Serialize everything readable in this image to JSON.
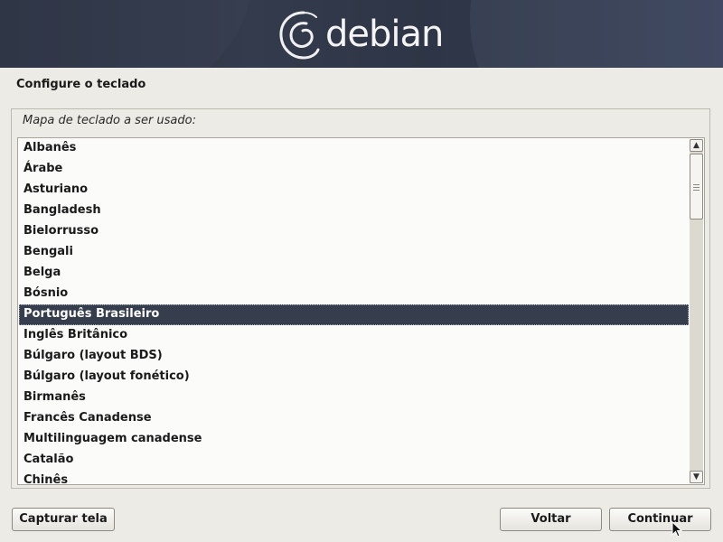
{
  "banner": {
    "logo_text": "debian"
  },
  "page": {
    "title": "Configure o teclado",
    "prompt": "Mapa de teclado a ser usado:"
  },
  "keymap_list": {
    "items": [
      "Albanês",
      "Árabe",
      "Asturiano",
      "Bangladesh",
      "Bielorrusso",
      "Bengali",
      "Belga",
      "Bósnio",
      "Português Brasileiro",
      "Inglês Britânico",
      "Búlgaro (layout BDS)",
      "Búlgaro (layout fonético)",
      "Birmanês",
      "Francês Canadense",
      "Multilinguagem canadense",
      "Catalão",
      "Chinês"
    ],
    "selected": "Português Brasileiro"
  },
  "buttons": {
    "capture": "Capturar tela",
    "back": "Voltar",
    "continue": "Continuar"
  },
  "colors": {
    "banner_bg": "#2f3646",
    "selection_bg": "#363d4d",
    "window_bg": "#edebe5"
  }
}
